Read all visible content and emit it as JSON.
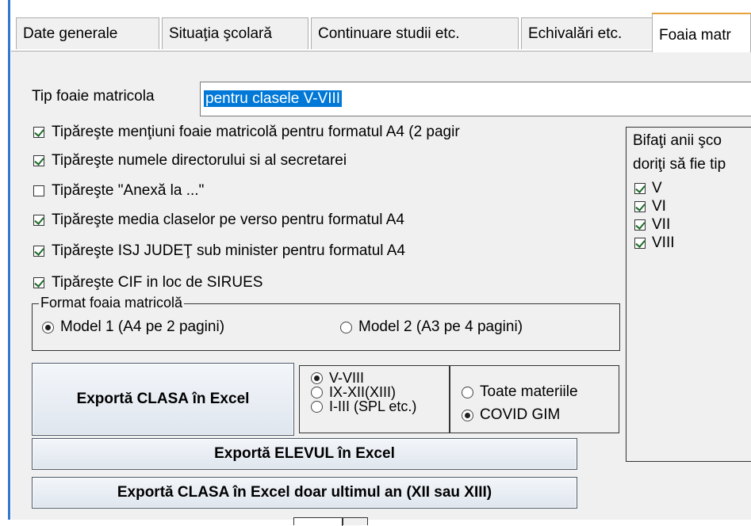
{
  "tabs": [
    {
      "label": "Date generale"
    },
    {
      "label": "Situaţia şcolară"
    },
    {
      "label": "Continuare studii etc."
    },
    {
      "label": "Echivalări etc."
    },
    {
      "label": "Foaia matr"
    }
  ],
  "tip_foaie": {
    "label": "Tip foaie matricola",
    "value": "pentru clasele V-VIII"
  },
  "checkboxes": [
    {
      "label": "Tipăreşte menţiuni foaie matricolă pentru formatul A4 (2 pagir",
      "checked": true
    },
    {
      "label": "Tipăreşte numele directorului si al secretarei",
      "checked": true
    },
    {
      "label": "Tipăreşte \"Anexă la ...\"",
      "checked": false
    },
    {
      "label": "Tipăreşte media claselor pe verso pentru formatul A4",
      "checked": true
    },
    {
      "label": "Tipăreşte ISJ JUDEŢ sub minister pentru formatul A4",
      "checked": true
    },
    {
      "label": "Tipăreşte CIF in loc de SIRUES",
      "checked": true
    }
  ],
  "format_group": {
    "title": "Format foaia matricolă",
    "options": [
      {
        "label": "Model 1 (A4 pe 2 pagini)",
        "selected": true
      },
      {
        "label": "Model 2 (A3 pe 4 pagini)",
        "selected": false
      }
    ]
  },
  "export_class_button": "Exportă  CLASA  în Excel",
  "level_options": [
    {
      "label": "V-VIII",
      "selected": true
    },
    {
      "label": "IX-XII(XIII)",
      "selected": false
    },
    {
      "label": "I-III (SPL etc.)",
      "selected": false
    }
  ],
  "subject_options": [
    {
      "label": "Toate materiile",
      "selected": false
    },
    {
      "label": "COVID GIM",
      "selected": true
    }
  ],
  "export_student_button": "Exportă ELEVUL în Excel",
  "export_last_year_button": "Exportă  CLASA  în Excel doar ultimul an (XII sau XIII)",
  "years_box": {
    "line1": "Bifaţi anii şco",
    "line2": "doriţi să fie tip",
    "years": [
      {
        "label": "V",
        "checked": true
      },
      {
        "label": "VI",
        "checked": true
      },
      {
        "label": "VII",
        "checked": true
      },
      {
        "label": "VIII",
        "checked": true
      }
    ]
  },
  "colors": {
    "active_tab_accent": "#e8a23c",
    "selection": "#0078d7",
    "window_border": "#2f77d0"
  }
}
